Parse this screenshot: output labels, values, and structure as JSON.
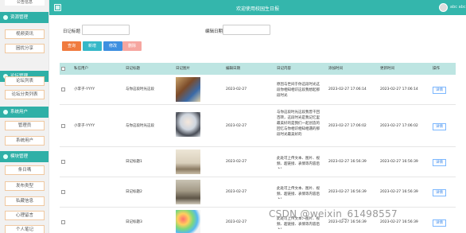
{
  "sidebar": {
    "top_item": "公告信息",
    "groups": [
      {
        "label": "资源管理",
        "items": [
          "视频资讯",
          "困扰分享"
        ]
      },
      {
        "label": "论坛管理",
        "items": [
          "论坛列表",
          "论坛分类列表"
        ]
      },
      {
        "label": "系统用户",
        "items": [
          "管理员",
          "系统用户"
        ]
      },
      {
        "label": "模块管理",
        "items": [
          "条日嗎",
          "发布类型",
          "私藏信息",
          "心理留言",
          "个人笔记"
        ]
      }
    ]
  },
  "topbar": {
    "title": "欢迎使用校园生日报",
    "user_name": "abc abc"
  },
  "search": {
    "label1": "日记标题",
    "label2": "编辑日期",
    "input1_value": "",
    "input2_value": ""
  },
  "buttons": {
    "search": "查询",
    "add": "新增",
    "edit": "修改",
    "delete": "删除",
    "colors": {
      "search": "#f07b3f",
      "add": "#35b8c8",
      "edit": "#3d8fe0",
      "delete": "#f6a6a0"
    }
  },
  "table": {
    "headers": [
      "私信用户",
      "日记标题",
      "日记图片",
      "编辑日期",
      "日记内容",
      "添加时间",
      "更新时间",
      "操作"
    ],
    "detail_label": "详情",
    "rows": [
      {
        "user": "小李子-YYYY",
        "title": "与你这段时光这段",
        "date": "2023-02-27",
        "content": "原因与世间于你这段时光这段你相知相识这段我想起那段时光",
        "created": "2023-02-27 17:06:14",
        "updated": "2023-02-27 17:06:14",
        "image": "cards-icon"
      },
      {
        "user": "小李子-YYYY",
        "title": "与你这段时光这段",
        "date": "2023-02-27",
        "content": "与你这段时光这段我曾千回百转，这段时光是我记忆里最美好的是我们一起创造的回忆与你相识相知相遇的那段时光最美好的",
        "created": "2023-02-27 17:06:02",
        "updated": "2023-02-27 17:06:02",
        "image": "anime-icon"
      },
      {
        "user": "",
        "title": "日记标题1",
        "date": "2023-02-27",
        "content": "此处可上传文本、图片、视频、超链接、表情等内容后上！",
        "created": "2023-02-27 16:56:39",
        "updated": "2023-02-27 16:56:39",
        "image": "photo-icon"
      },
      {
        "user": "",
        "title": "日记标题2",
        "date": "2023-02-27",
        "content": "此处可上传文本、图片、视频、超链接、表情等内容后上！",
        "created": "2023-02-27 16:56:39",
        "updated": "2023-02-27 16:56:39",
        "image": "room-icon"
      },
      {
        "user": "",
        "title": "日记标题3",
        "date": "2023-02-27",
        "content": "此处可上传文本、图片、视频、超链接、表情等内容后上！",
        "created": "2023-02-27 16:56:39",
        "updated": "2023-02-27 16:56:39",
        "image": "candy-icon"
      }
    ]
  },
  "watermark": "CSDN @weixin_61498557"
}
